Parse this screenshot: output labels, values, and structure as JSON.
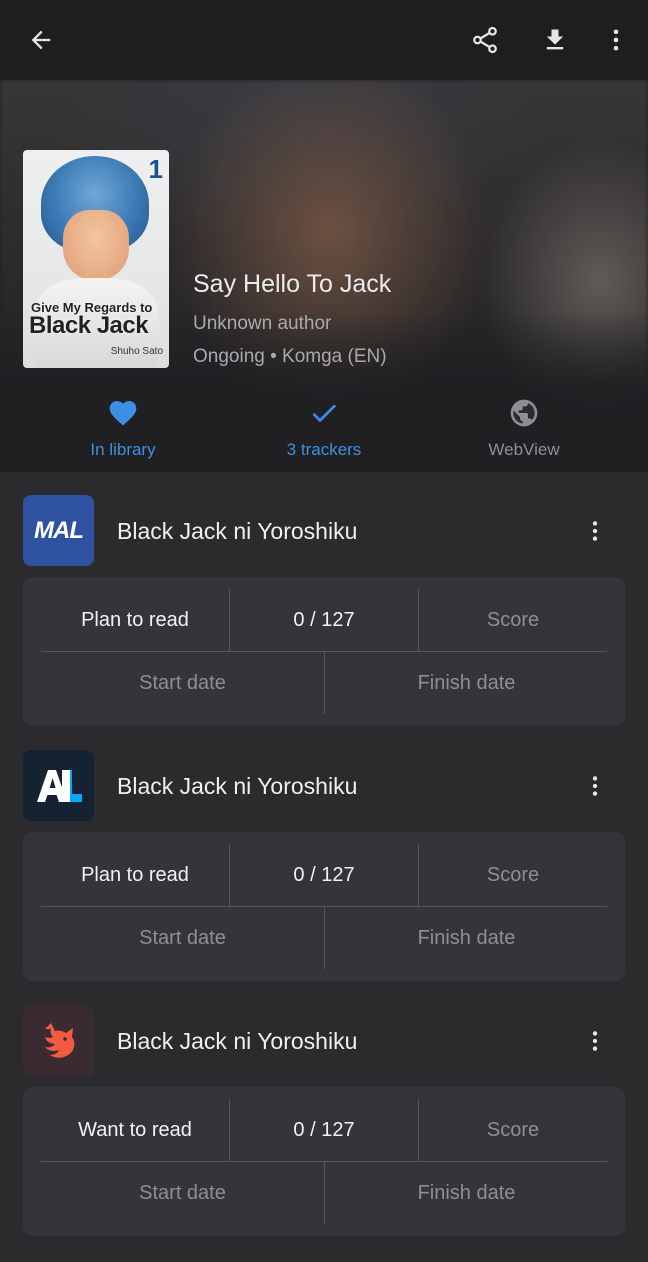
{
  "app_bar": {
    "back_icon": "arrow-left-icon",
    "share_icon": "share-icon",
    "download_icon": "download-icon",
    "overflow_icon": "more-vert-icon"
  },
  "manga": {
    "title": "Say Hello To Jack",
    "author": "Unknown author",
    "status_source": "Ongoing • Komga (EN)",
    "cover": {
      "volume": "1",
      "title_line1": "Give My Regards to",
      "title_line2": "Black Jack",
      "artist": "Shuho Sato"
    }
  },
  "actions": [
    {
      "label": "In library",
      "icon": "heart-icon",
      "color": "#3d8ee6"
    },
    {
      "label": "3 trackers",
      "icon": "check-icon",
      "color": "#3d8ee6"
    },
    {
      "label": "WebView",
      "icon": "globe-icon",
      "color": "#8e8e93"
    }
  ],
  "trackers": [
    {
      "service": "MAL",
      "logo_text": "MAL",
      "logo_bg": "#2e51a2",
      "name": "Black Jack ni Yoroshiku",
      "status": "Plan to read",
      "chapters": "0 / 127",
      "score": "Score",
      "start_date": "Start date",
      "finish_date": "Finish date"
    },
    {
      "service": "AniList",
      "logo_text": "AL",
      "logo_bg": "#152232",
      "name": "Black Jack ni Yoroshiku",
      "status": "Plan to read",
      "chapters": "0 / 127",
      "score": "Score",
      "start_date": "Start date",
      "finish_date": "Finish date"
    },
    {
      "service": "Kitsu",
      "logo_text": "",
      "logo_bg": "#3a2b32",
      "name": "Black Jack ni Yoroshiku",
      "status": "Want to read",
      "chapters": "0 / 127",
      "score": "Score",
      "start_date": "Start date",
      "finish_date": "Finish date"
    }
  ]
}
